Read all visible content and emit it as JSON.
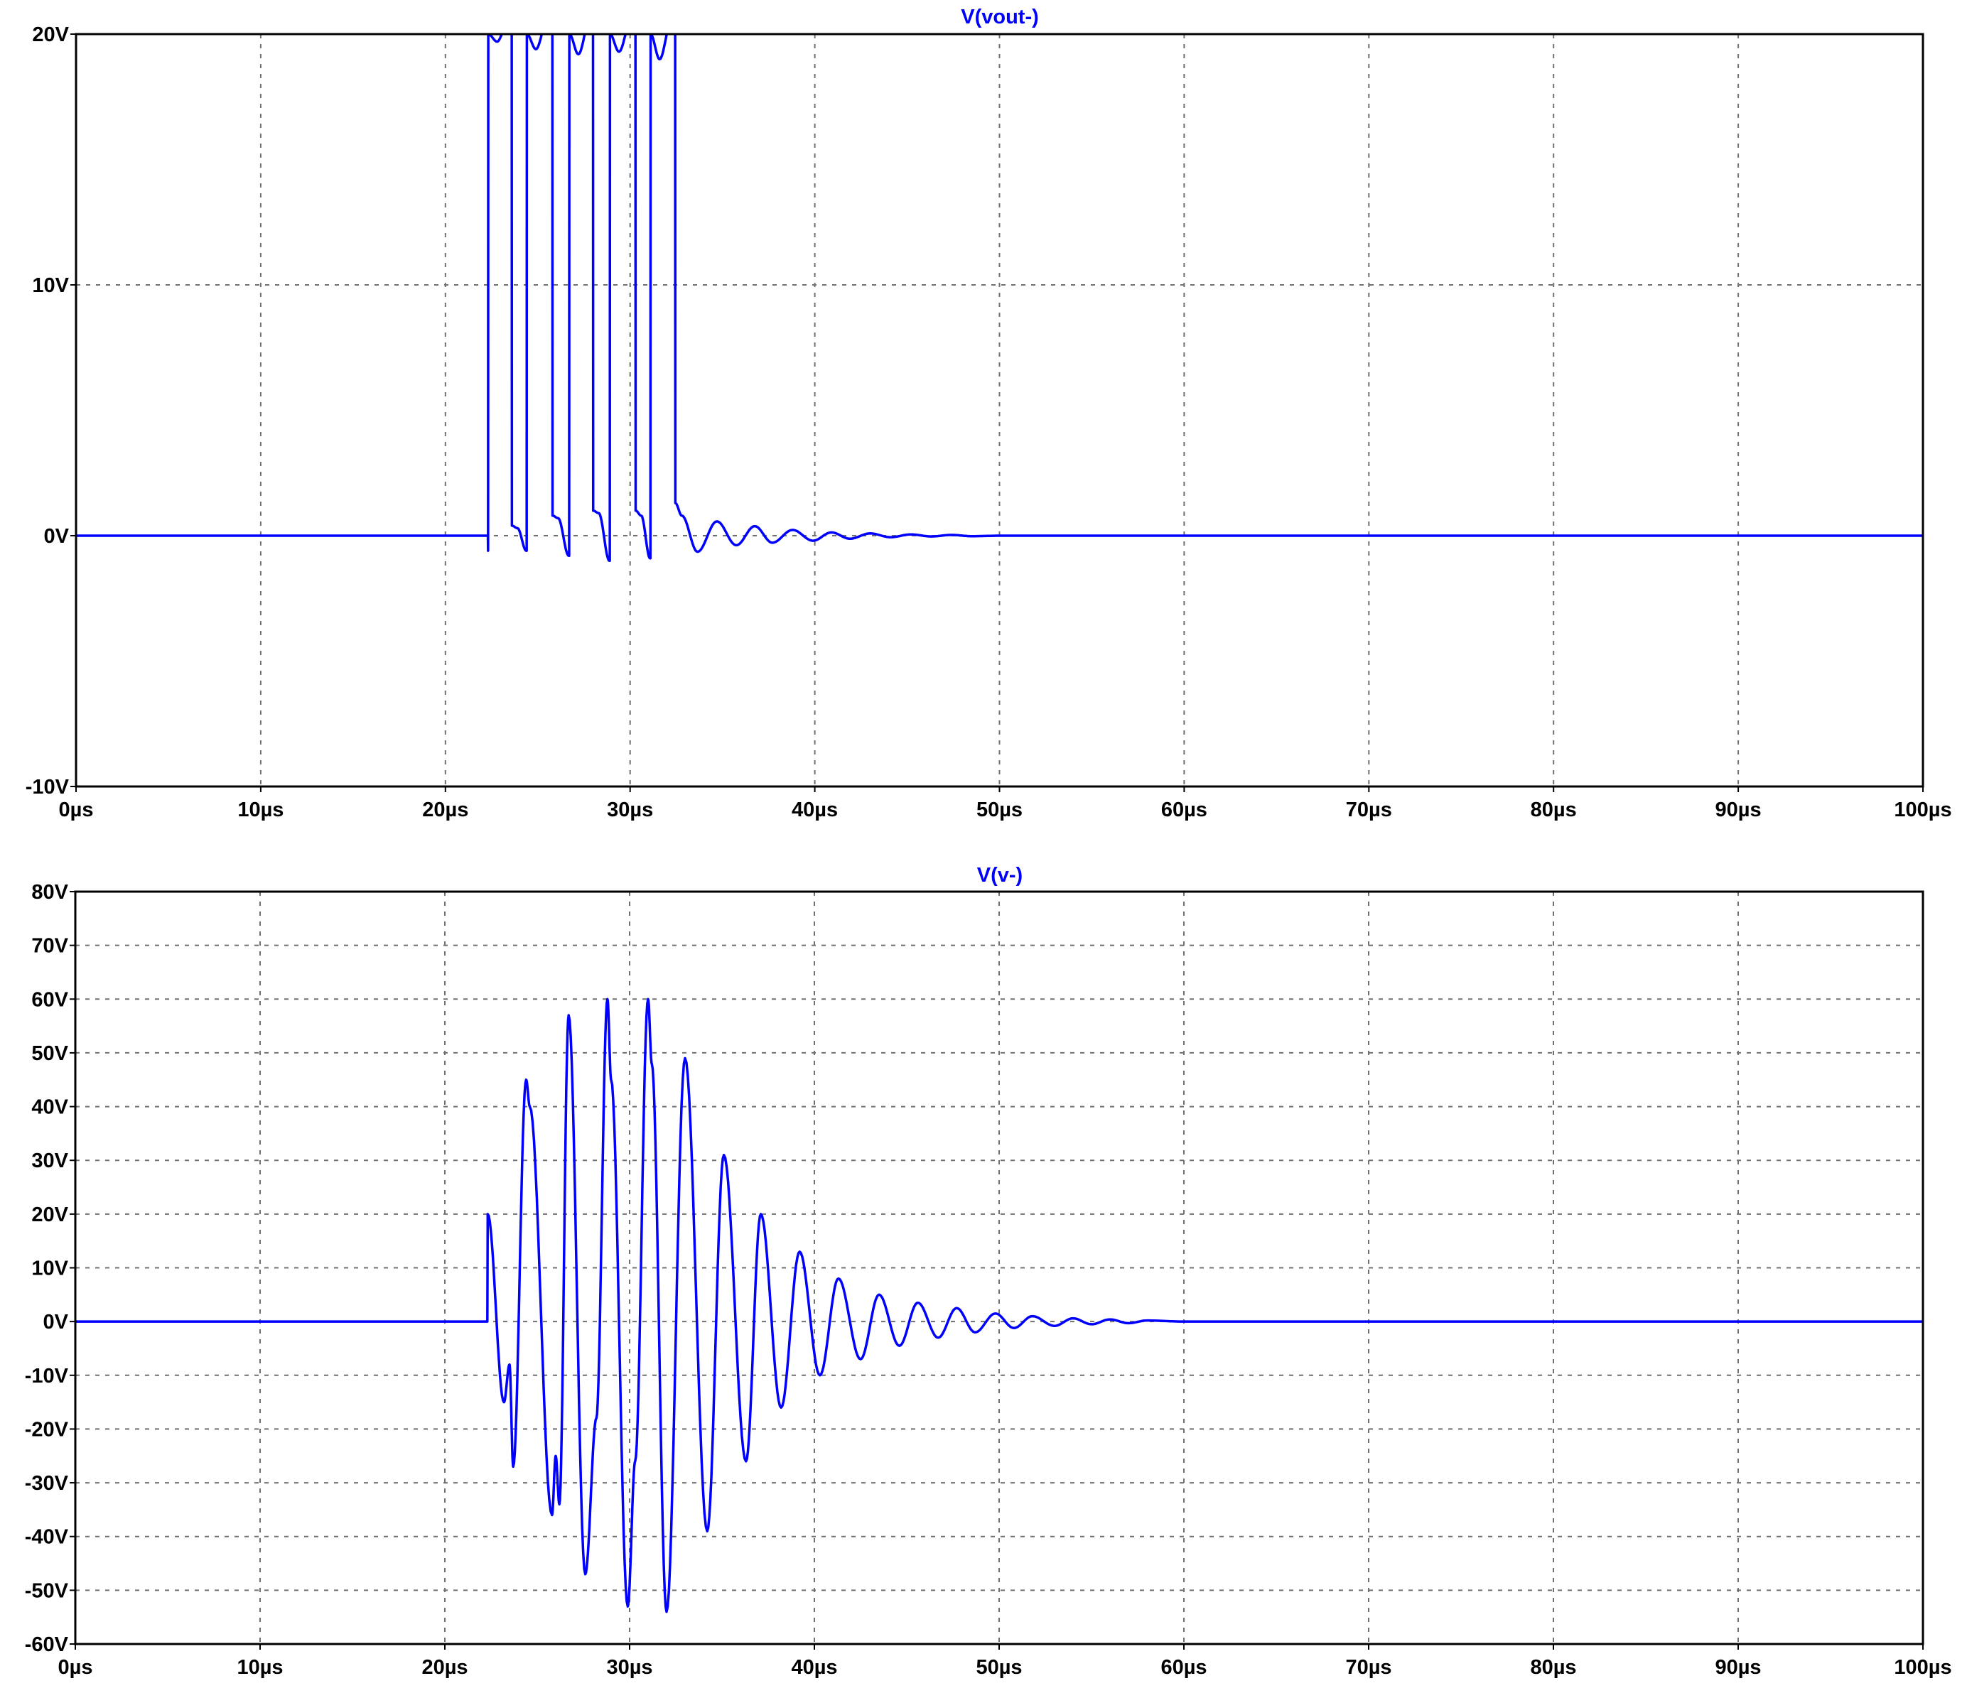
{
  "chart_data": [
    {
      "type": "line",
      "title": "V(vout-)",
      "xlabel": "",
      "ylabel": "",
      "xlim": [
        0,
        100
      ],
      "ylim": [
        -10,
        20
      ],
      "x_unit": "µs",
      "xticks": [
        0,
        10,
        20,
        30,
        40,
        50,
        60,
        70,
        80,
        90,
        100
      ],
      "xtick_labels": [
        "0µs",
        "10µs",
        "20µs",
        "30µs",
        "40µs",
        "50µs",
        "60µs",
        "70µs",
        "80µs",
        "90µs",
        "100µs"
      ],
      "yticks": [
        -10,
        0,
        10,
        20
      ],
      "ytick_labels": [
        "-10V",
        "0V",
        "10V",
        "20V"
      ],
      "grid": true,
      "color": "#0000FF",
      "series": [
        {
          "name": "V(vout-)",
          "points": [
            [
              0,
              0
            ],
            [
              22.3,
              0
            ],
            [
              22.31,
              -0.6
            ],
            [
              22.32,
              20
            ],
            [
              22.8,
              19.7
            ],
            [
              23.3,
              20.3
            ],
            [
              23.59,
              21
            ],
            [
              23.6,
              0.4
            ],
            [
              23.9,
              0.3
            ],
            [
              24.38,
              -0.6
            ],
            [
              24.4,
              -0.6
            ],
            [
              24.41,
              20
            ],
            [
              24.9,
              19.4
            ],
            [
              25.5,
              20.5
            ],
            [
              25.79,
              21
            ],
            [
              25.8,
              0.8
            ],
            [
              26.1,
              0.7
            ],
            [
              26.68,
              -0.8
            ],
            [
              26.7,
              -0.8
            ],
            [
              26.71,
              20
            ],
            [
              27.2,
              19.2
            ],
            [
              27.8,
              20.5
            ],
            [
              27.99,
              21
            ],
            [
              28.0,
              1.0
            ],
            [
              28.3,
              0.9
            ],
            [
              28.88,
              -1.0
            ],
            [
              28.9,
              -1.0
            ],
            [
              28.91,
              20
            ],
            [
              29.4,
              19.3
            ],
            [
              30.0,
              20.4
            ],
            [
              30.29,
              21
            ],
            [
              30.3,
              1.0
            ],
            [
              30.6,
              0.8
            ],
            [
              31.08,
              -0.9
            ],
            [
              31.1,
              -0.9
            ],
            [
              31.11,
              20
            ],
            [
              31.6,
              19.0
            ],
            [
              32.2,
              20.4
            ],
            [
              32.44,
              21
            ],
            [
              32.45,
              1.3
            ],
            [
              32.8,
              0.8
            ],
            [
              33.65,
              -0.64
            ],
            [
              34.7,
              0.57
            ],
            [
              35.75,
              -0.38
            ],
            [
              36.75,
              0.38
            ],
            [
              37.7,
              -0.28
            ],
            [
              38.8,
              0.23
            ],
            [
              39.9,
              -0.2
            ],
            [
              40.9,
              0.13
            ],
            [
              41.9,
              -0.12
            ],
            [
              43.0,
              0.09
            ],
            [
              44.1,
              -0.06
            ],
            [
              45.2,
              0.05
            ],
            [
              46.3,
              -0.03
            ],
            [
              47.4,
              0.03
            ],
            [
              48.5,
              -0.02
            ],
            [
              50,
              0
            ],
            [
              100,
              0
            ]
          ]
        }
      ]
    },
    {
      "type": "line",
      "title": "V(v-)",
      "xlabel": "",
      "ylabel": "",
      "xlim": [
        0,
        100
      ],
      "ylim": [
        -60,
        80
      ],
      "x_unit": "µs",
      "xticks": [
        0,
        10,
        20,
        30,
        40,
        50,
        60,
        70,
        80,
        90,
        100
      ],
      "xtick_labels": [
        "0µs",
        "10µs",
        "20µs",
        "30µs",
        "40µs",
        "50µs",
        "60µs",
        "70µs",
        "80µs",
        "90µs",
        "100µs"
      ],
      "yticks": [
        -60,
        -50,
        -40,
        -30,
        -20,
        -10,
        0,
        10,
        20,
        30,
        40,
        50,
        60,
        70,
        80
      ],
      "ytick_labels": [
        "-60V",
        "-50V",
        "-40V",
        "-30V",
        "-20V",
        "-10V",
        "0V",
        "10V",
        "20V",
        "30V",
        "40V",
        "50V",
        "60V",
        "70V",
        "80V"
      ],
      "grid": true,
      "color": "#0000FF",
      "series": [
        {
          "name": "V(v-)",
          "points": [
            [
              0,
              0
            ],
            [
              22.3,
              0
            ],
            [
              22.32,
              20
            ],
            [
              23.2,
              -15
            ],
            [
              23.5,
              -8
            ],
            [
              23.7,
              -27
            ],
            [
              24.4,
              45
            ],
            [
              24.6,
              40
            ],
            [
              25.8,
              -36
            ],
            [
              26.0,
              -25
            ],
            [
              26.2,
              -34
            ],
            [
              26.7,
              57
            ],
            [
              27.6,
              -47
            ],
            [
              28.2,
              -18
            ],
            [
              28.8,
              60
            ],
            [
              29.0,
              45
            ],
            [
              29.9,
              -53
            ],
            [
              30.3,
              -26
            ],
            [
              31.0,
              60
            ],
            [
              31.2,
              48
            ],
            [
              32.0,
              -54
            ],
            [
              33.0,
              49
            ],
            [
              34.2,
              -39
            ],
            [
              35.1,
              31
            ],
            [
              36.3,
              -26
            ],
            [
              37.1,
              20
            ],
            [
              38.2,
              -16
            ],
            [
              39.2,
              13
            ],
            [
              40.3,
              -10
            ],
            [
              41.3,
              8
            ],
            [
              42.5,
              -7
            ],
            [
              43.5,
              5
            ],
            [
              44.6,
              -4.5
            ],
            [
              45.6,
              3.5
            ],
            [
              46.7,
              -3
            ],
            [
              47.7,
              2.5
            ],
            [
              48.7,
              -2
            ],
            [
              49.8,
              1.5
            ],
            [
              50.8,
              -1.2
            ],
            [
              51.8,
              1
            ],
            [
              53,
              -0.8
            ],
            [
              54,
              0.6
            ],
            [
              55,
              -0.5
            ],
            [
              56,
              0.4
            ],
            [
              57,
              -0.3
            ],
            [
              58,
              0.2
            ],
            [
              60,
              0
            ],
            [
              100,
              0
            ]
          ]
        }
      ]
    }
  ]
}
